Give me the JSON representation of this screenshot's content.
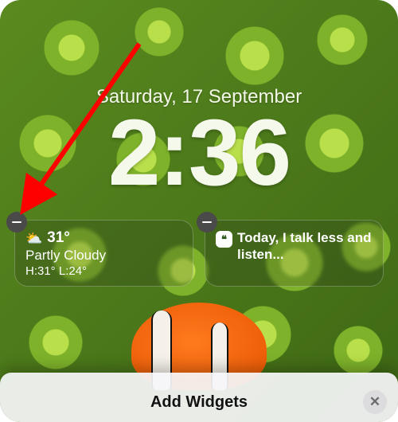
{
  "lockscreen": {
    "date": "Saturday, 17 September",
    "time": "2:36"
  },
  "widgets": [
    {
      "kind": "weather",
      "icon_glyph": "⛅",
      "temperature": "31°",
      "condition": "Partly Cloudy",
      "hilo": "H:31° L:24°"
    },
    {
      "kind": "quote",
      "icon_glyph": "❝",
      "text": "Today, I talk less and listen..."
    }
  ],
  "sheet": {
    "title": "Add Widgets"
  },
  "annotation": {
    "arrow_color": "#ff0000"
  }
}
